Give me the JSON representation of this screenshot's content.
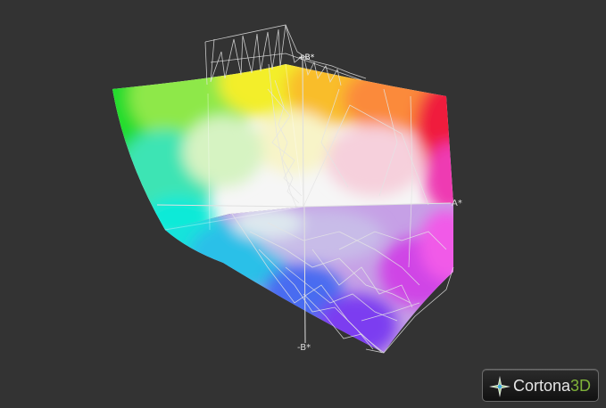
{
  "viewer": {
    "background": "#333333",
    "axes": {
      "positive_a": "A*",
      "negative_b": "-B*",
      "positive_b": "+B*"
    },
    "logo": {
      "brand": "Cortona",
      "suffix": "3D",
      "icon": "cortona-star-icon",
      "accent_color": "#7fb239"
    }
  }
}
